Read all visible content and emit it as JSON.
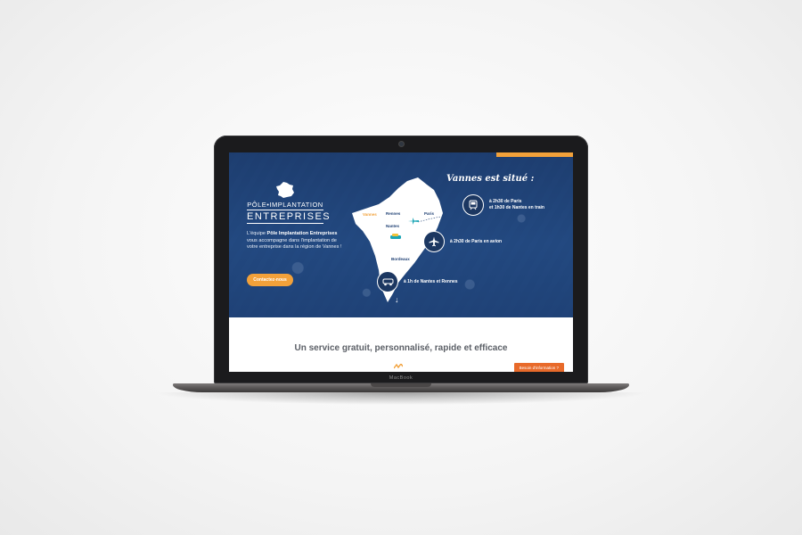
{
  "device": {
    "brand": "MacBook"
  },
  "site": {
    "logo": {
      "line1": "PÔLE•IMPLANTATION",
      "line2": "ENTREPRISES"
    },
    "intro": {
      "prefix": "L'équipe ",
      "strong": "Pôle Implantation Entreprises",
      "suffix": " vous accompagne dans l'implantation de votre entreprise dans la région de Vannes !"
    },
    "cta_label": "Contactez-nous",
    "headline": "Vannes est situé :",
    "cities": {
      "vannes": "Vannes",
      "rennes": "Rennes",
      "paris": "Paris",
      "nantes": "Nantes",
      "bordeaux": "Bordeaux"
    },
    "travel": [
      {
        "icon": "train-icon",
        "line1": "à 2h30 de Paris",
        "line2": "et 1h30 de Nantes en train"
      },
      {
        "icon": "plane-icon",
        "line1": "à 2h30 de Paris en avion",
        "line2": ""
      },
      {
        "icon": "car-icon",
        "line1": "à 1h de Nantes et Rennes",
        "line2": ""
      }
    ],
    "scroll_arrow": "↓",
    "subtitle": "Un service gratuit, personnalisé, rapide et efficace",
    "info_badge": "Besoin d'information ?"
  },
  "colors": {
    "navy": "#1e3f73",
    "accent_orange": "#f2a13a",
    "badge_orange": "#e86a2a"
  }
}
